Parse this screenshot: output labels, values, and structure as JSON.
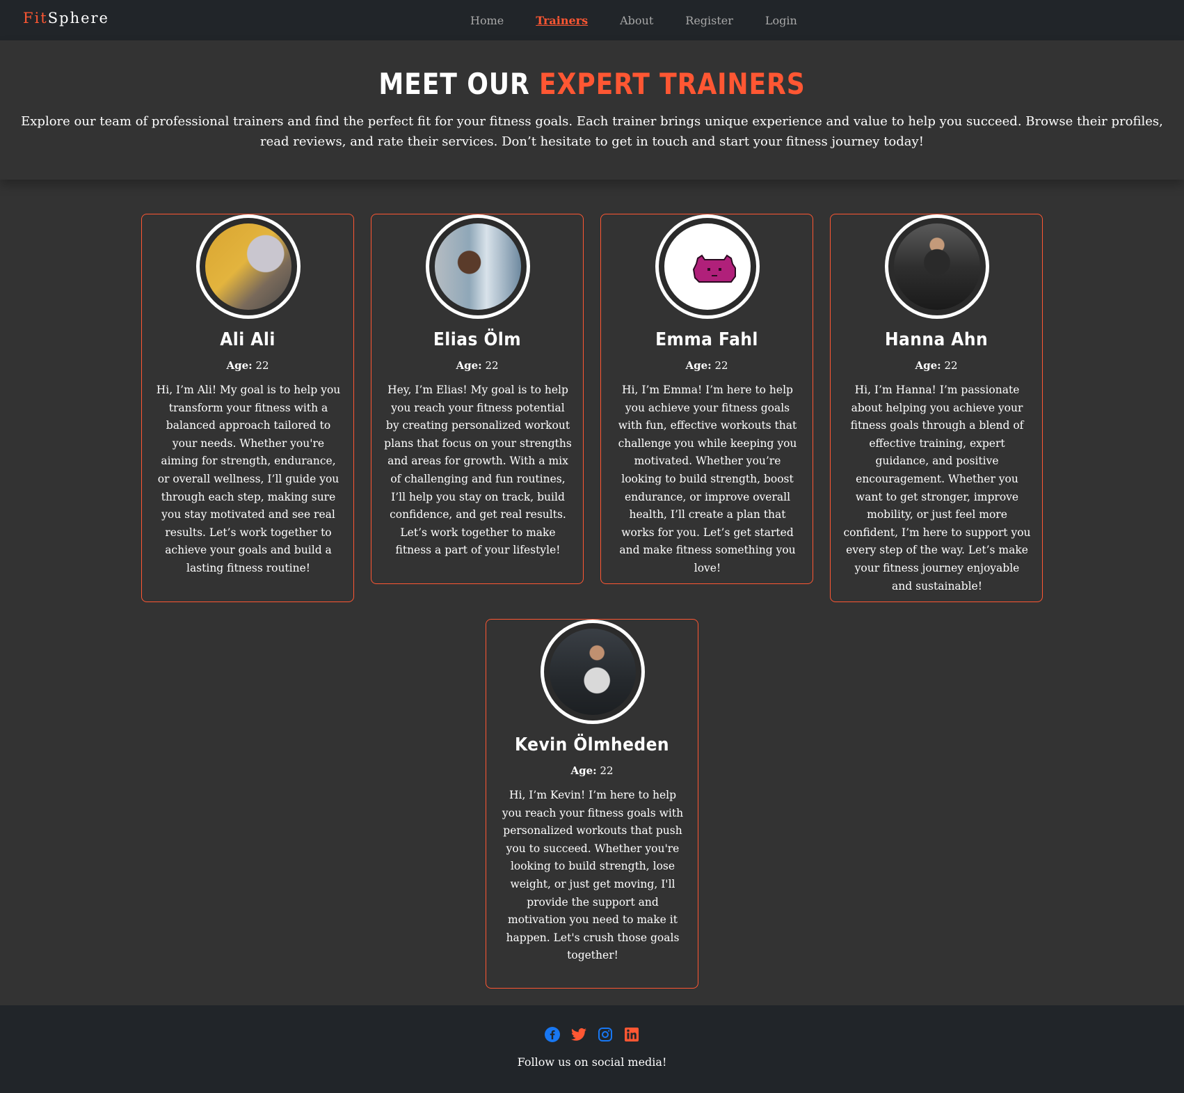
{
  "nav": {
    "brand_part1": "Fit",
    "brand_part2": "Sphere",
    "links": [
      {
        "label": "Home"
      },
      {
        "label": "Trainers"
      },
      {
        "label": "About"
      },
      {
        "label": "Register"
      },
      {
        "label": "Login"
      }
    ],
    "active": "Trainers"
  },
  "hero": {
    "title_part1": "MEET OUR ",
    "title_part2": "EXPERT TRAINERS",
    "description": "Explore our team of professional trainers and find the perfect fit for your fitness goals. Each trainer brings unique experience and value to help you succeed. Browse their profiles, read reviews, and rate their services. Don’t hesitate to get in touch and start your fitness journey today!"
  },
  "trainers": [
    {
      "name": "Ali Ali",
      "age_label": "Age:",
      "age": "22",
      "bio": "Hi, I’m Ali! My goal is to help you transform your fitness with a balanced approach tailored to your needs. Whether you're aiming for strength, endurance, or overall wellness, I’ll guide you through each step, making sure you stay motivated and see real results. Let’s work together to achieve your goals and build a lasting fitness routine!"
    },
    {
      "name": "Elias Ölm",
      "age_label": "Age:",
      "age": "22",
      "bio": "Hey, I’m Elias! My goal is to help you reach your fitness potential by creating personalized workout plans that focus on your strengths and areas for growth. With a mix of challenging and fun routines, I’ll help you stay on track, build confidence, and get real results. Let’s work together to make fitness a part of your lifestyle!"
    },
    {
      "name": "Emma Fahl",
      "age_label": "Age:",
      "age": "22",
      "bio": "Hi, I’m Emma! I’m here to help you achieve your fitness goals with fun, effective workouts that challenge you while keeping you motivated. Whether you’re looking to build strength, boost endurance, or improve overall health, I’ll create a plan that works for you. Let’s get started and make fitness something you love!"
    },
    {
      "name": "Hanna Ahn",
      "age_label": "Age:",
      "age": "22",
      "bio": "Hi, I’m Hanna! I’m passionate about helping you achieve your fitness goals through a blend of effective training, expert guidance, and positive encouragement. Whether you want to get stronger, improve mobility, or just feel more confident, I’m here to support you every step of the way. Let’s make your fitness journey enjoyable and sustainable!"
    },
    {
      "name": "Kevin Ölmheden",
      "age_label": "Age:",
      "age": "22",
      "bio": "Hi, I’m Kevin! I’m here to help you reach your fitness goals with personalized workouts that push you to succeed. Whether you're looking to build strength, lose weight, or just get moving, I'll provide the support and motivation you need to make it happen. Let's crush those goals together!"
    }
  ],
  "footer": {
    "text": "Follow us on social media!",
    "icons": [
      "facebook-icon",
      "twitter-icon",
      "instagram-icon",
      "linkedin-icon"
    ]
  },
  "colors": {
    "accent": "#ff5733",
    "background": "#333333",
    "nav_background": "#212529",
    "facebook": "#1877f2"
  }
}
